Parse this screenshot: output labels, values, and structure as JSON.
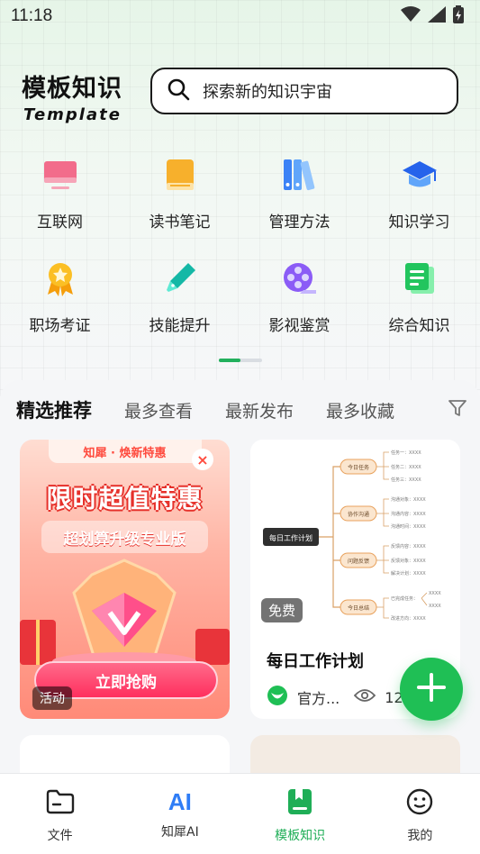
{
  "status_bar": {
    "time": "11:18"
  },
  "header": {
    "brand_cn": "模板知识",
    "brand_en": "Template",
    "search_placeholder": "探索新的知识宇宙"
  },
  "categories": [
    {
      "label": "互联网",
      "icon": "monitor-icon"
    },
    {
      "label": "读书笔记",
      "icon": "book-icon"
    },
    {
      "label": "管理方法",
      "icon": "binders-icon"
    },
    {
      "label": "知识学习",
      "icon": "graduation-cap-icon"
    },
    {
      "label": "职场考证",
      "icon": "award-medal-icon"
    },
    {
      "label": "技能提升",
      "icon": "pen-nib-icon"
    },
    {
      "label": "影视鉴赏",
      "icon": "film-reel-icon"
    },
    {
      "label": "综合知识",
      "icon": "document-icon"
    }
  ],
  "pager": {
    "active_index": 0,
    "pages": 2
  },
  "tabs": [
    {
      "label": "精选推荐",
      "active": true
    },
    {
      "label": "最多查看",
      "active": false
    },
    {
      "label": "最新发布",
      "active": false
    },
    {
      "label": "最多收藏",
      "active": false
    }
  ],
  "promo_card": {
    "top_label": "知犀 · 焕新特惠",
    "title": "限时超值特惠",
    "subtitle": "超划算升级专业版",
    "button": "立即抢购",
    "tag": "活动"
  },
  "plan_card": {
    "tag": "免费",
    "title": "每日工作计划",
    "author": "官方...",
    "views": "12",
    "mindmap": {
      "root": "每日工作计划",
      "branches": [
        {
          "label": "今日任务",
          "leaves": [
            "任务一：XXXX",
            "任务二：XXXX",
            "任务三：XXXX"
          ]
        },
        {
          "label": "协作沟通",
          "leaves": [
            "沟通对象：XXXX",
            "沟通内容：XXXX",
            "沟通时间：XXXX"
          ]
        },
        {
          "label": "问题反馈",
          "leaves": [
            "反馈内容：XXXX",
            "反馈对象：XXXX",
            "解决计划：XXXX"
          ]
        },
        {
          "label": "今日总结",
          "leaves": [
            "已完成任务：",
            "XXXX",
            "XXXX",
            "改进方向：XXXX"
          ]
        }
      ]
    }
  },
  "bottom_nav": [
    {
      "label": "文件",
      "icon": "folder-icon",
      "active": false
    },
    {
      "label": "知犀AI",
      "icon": "ai-icon",
      "active": false,
      "icon_text": "AI"
    },
    {
      "label": "模板知识",
      "icon": "bookmark-book-icon",
      "active": true
    },
    {
      "label": "我的",
      "icon": "smiley-face-icon",
      "active": false
    }
  ],
  "colors": {
    "accent": "#1fae57",
    "fab": "#1fbf55",
    "promo": "#ff4b3e"
  }
}
